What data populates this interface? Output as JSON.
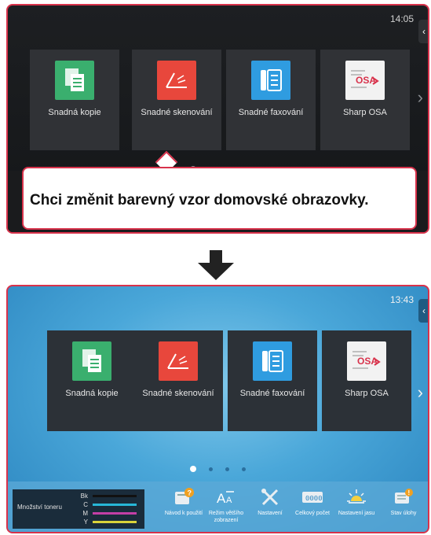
{
  "top_screen": {
    "clock": "14:05",
    "tiles": [
      {
        "label": "Snadná kopie",
        "icon": "copy-icon"
      },
      {
        "label": "Snadné skenování",
        "icon": "scan-icon"
      },
      {
        "label": "Snadné faxování",
        "icon": "fax-icon"
      },
      {
        "label": "Sharp OSA",
        "icon": "osa-icon"
      }
    ]
  },
  "callout": {
    "text": "Chci změnit barevný vzor domovské obrazovky."
  },
  "bottom_screen": {
    "clock": "13:43",
    "tiles": [
      {
        "label": "Snadná kopie",
        "icon": "copy-icon"
      },
      {
        "label": "Snadné skenování",
        "icon": "scan-icon"
      },
      {
        "label": "Snadné faxování",
        "icon": "fax-icon"
      },
      {
        "label": "Sharp OSA",
        "icon": "osa-icon"
      }
    ],
    "toner": {
      "title": "Množství toneru",
      "rows": [
        {
          "label": "Bk",
          "color": "#111111"
        },
        {
          "label": "C",
          "color": "#27b7d8"
        },
        {
          "label": "M",
          "color": "#c43fa6"
        },
        {
          "label": "Y",
          "color": "#d9d23a"
        }
      ]
    },
    "actions": [
      {
        "label": "Návod k použití",
        "icon": "manual-icon"
      },
      {
        "label": "Režim většího zobrazení",
        "icon": "large-display-icon"
      },
      {
        "label": "Nastavení",
        "icon": "settings-icon"
      },
      {
        "label": "Celkový počet",
        "icon": "counter-icon"
      },
      {
        "label": "Nastavení jasu",
        "icon": "brightness-icon"
      },
      {
        "label": "Stav úlohy",
        "icon": "job-status-icon"
      }
    ]
  },
  "colors": {
    "highlight_border": "#d8324b",
    "top_background": "#1d1f22",
    "bottom_background": "#4aa7d9"
  }
}
